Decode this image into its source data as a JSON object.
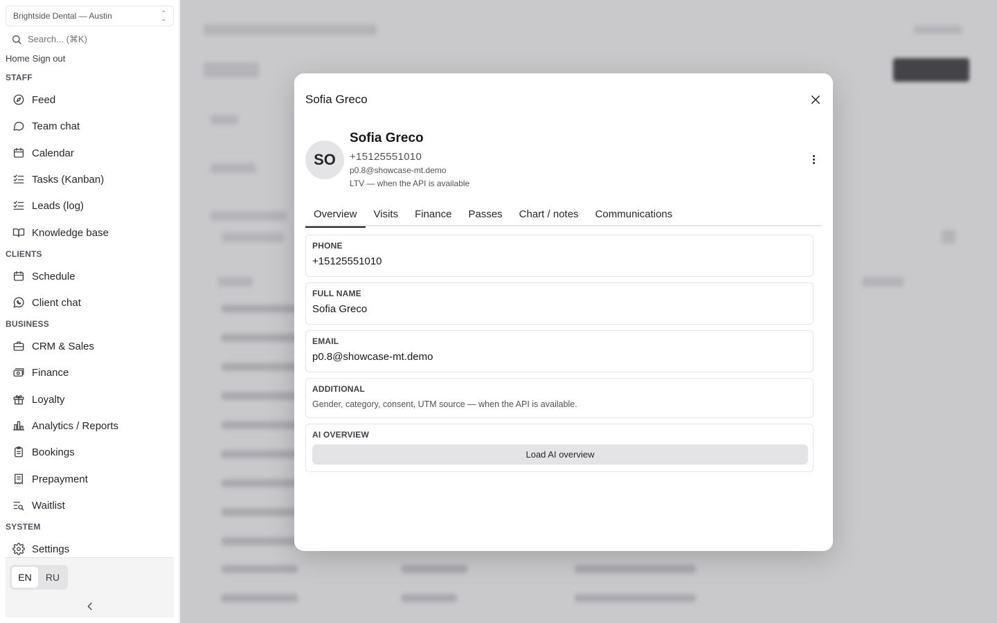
{
  "sidebar": {
    "org_select": "Brightside Dental — Austin",
    "search_placeholder": "Search... (⌘K)",
    "links": [
      "Home",
      "Sign out"
    ],
    "sections": {
      "staff": "STAFF",
      "clients": "CLIENTS",
      "business": "BUSINESS",
      "system": "SYSTEM"
    },
    "items": [
      {
        "label": "Feed",
        "icon": "compass-icon"
      },
      {
        "label": "Team chat",
        "icon": "chat-bubble-icon"
      },
      {
        "label": "Calendar",
        "icon": "calendar-icon"
      },
      {
        "label": "Tasks (Kanban)",
        "icon": "list-check-icon"
      },
      {
        "label": "Leads (log)",
        "icon": "list-check-icon"
      },
      {
        "label": "Knowledge base",
        "icon": "book-icon"
      },
      {
        "label": "Schedule",
        "icon": "calendar-icon"
      },
      {
        "label": "Client chat",
        "icon": "whatsapp-icon"
      },
      {
        "label": "CRM & Sales",
        "icon": "briefcase-icon"
      },
      {
        "label": "Finance",
        "icon": "banknote-icon"
      },
      {
        "label": "Loyalty",
        "icon": "gift-icon"
      },
      {
        "label": "Analytics / Reports",
        "icon": "bar-chart-icon"
      },
      {
        "label": "Bookings",
        "icon": "clipboard-icon"
      },
      {
        "label": "Prepayment",
        "icon": "receipt-icon"
      },
      {
        "label": "Waitlist",
        "icon": "list-search-icon"
      },
      {
        "label": "Settings",
        "icon": "gear-icon"
      }
    ],
    "languages": [
      "EN",
      "RU"
    ],
    "active_language": "EN"
  },
  "modal": {
    "title": "Sofia Greco",
    "avatar_initials": "SO",
    "name": "Sofia Greco",
    "phone": "+15125551010",
    "email": "p0.8@showcase-mt.demo",
    "ltv": "LTV — when the API is available",
    "tabs": [
      "Overview",
      "Visits",
      "Finance",
      "Passes",
      "Chart / notes",
      "Communications"
    ],
    "active_tab": "Overview",
    "fields": {
      "phone": {
        "label": "PHONE",
        "value": "+15125551010"
      },
      "full_name": {
        "label": "FULL NAME",
        "value": "Sofia Greco"
      },
      "email": {
        "label": "EMAIL",
        "value": "p0.8@showcase-mt.demo"
      },
      "additional": {
        "label": "ADDITIONAL",
        "note": "Gender, category, consent, UTM source — when the API is available."
      },
      "ai_overview": {
        "label": "AI OVERVIEW",
        "button": "Load AI overview"
      }
    }
  }
}
